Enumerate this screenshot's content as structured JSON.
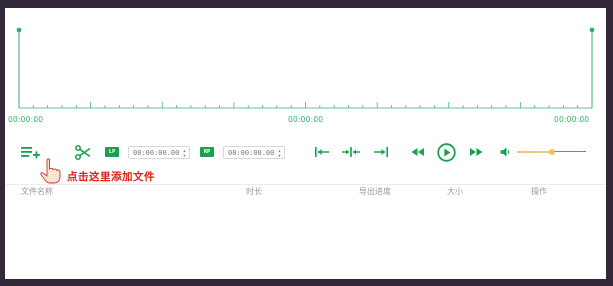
{
  "timeline": {
    "start_label": "00:00:00",
    "mid_label": "00:00:00",
    "end_label": "00:00:00"
  },
  "toolbar": {
    "lp_badge": "LP",
    "rp_badge": "RP",
    "lp_time": "00:00:00.00",
    "rp_time": "00:00:00.00",
    "volume_level": 0.5
  },
  "hint": {
    "text": "点击这里添加文件"
  },
  "table": {
    "columns": [
      "文件名称",
      "时长",
      "导出进度",
      "大小",
      "操作"
    ]
  },
  "colors": {
    "accent": "#1aa04f",
    "timeline_green": "#2fb36b",
    "volume_track": "#f3c97a",
    "hint_red": "#e0201a",
    "page_background": "#32283a"
  },
  "icons": {
    "add_file": "playlist-add-icon",
    "cut": "scissors-icon",
    "set_start": "arrow-to-left-bar-icon",
    "split": "split-icon",
    "set_end": "arrow-to-right-bar-icon",
    "rewind": "rewind-icon",
    "play": "play-icon",
    "forward": "fast-forward-icon",
    "volume": "volume-icon",
    "pointer": "hand-pointer-icon"
  }
}
